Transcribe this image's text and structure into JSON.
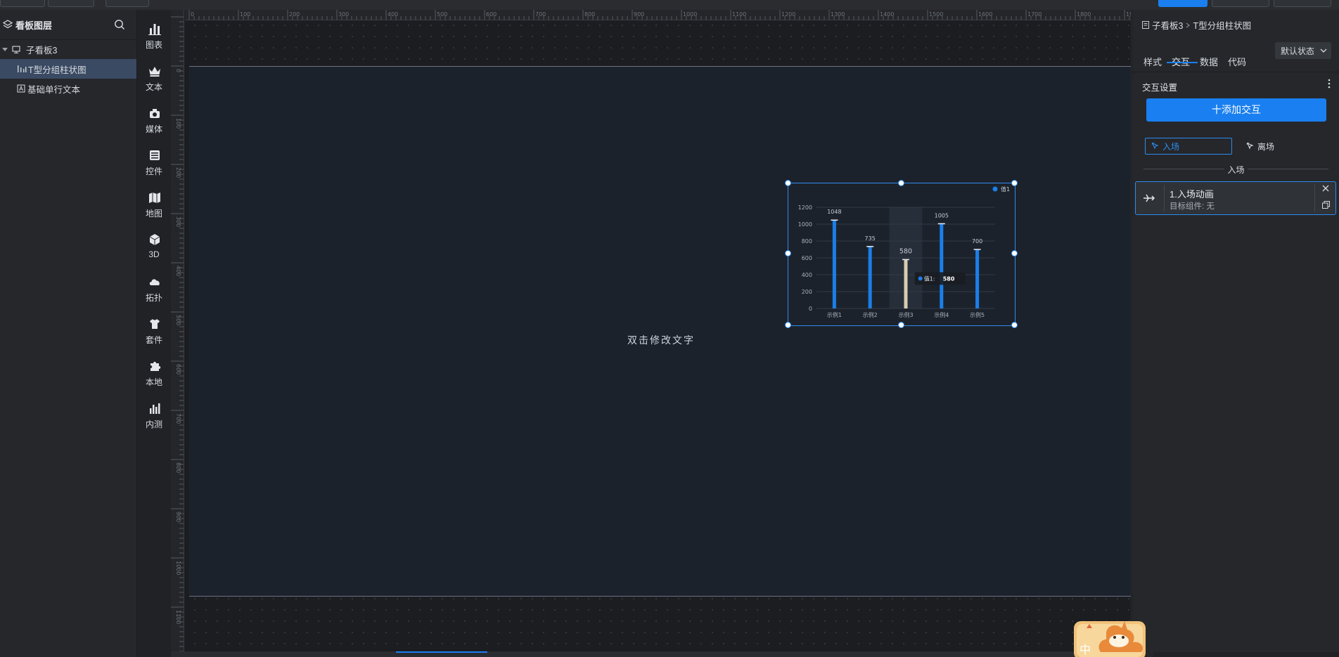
{
  "layers": {
    "title": "看板图层",
    "items": [
      {
        "label": "子看板3"
      },
      {
        "label": "T型分组柱状图"
      },
      {
        "label": "基础单行文本"
      }
    ]
  },
  "tools": [
    {
      "label": "图表",
      "icon": "bar-chart-icon"
    },
    {
      "label": "文本",
      "icon": "crown-icon"
    },
    {
      "label": "媒体",
      "icon": "media-icon"
    },
    {
      "label": "控件",
      "icon": "control-icon"
    },
    {
      "label": "地图",
      "icon": "map-icon"
    },
    {
      "label": "3D",
      "icon": "cube-icon"
    },
    {
      "label": "拓扑",
      "icon": "cloud-icon"
    },
    {
      "label": "套件",
      "icon": "shirt-icon"
    },
    {
      "label": "本地",
      "icon": "puzzle-icon"
    },
    {
      "label": "内测",
      "icon": "chart-icon"
    }
  ],
  "ruler": {
    "h_ticks": [
      "0",
      "100",
      "200",
      "300",
      "400",
      "500",
      "600",
      "700",
      "800",
      "900",
      "1000",
      "1100",
      "1200",
      "1300",
      "1400",
      "1500",
      "1600",
      "1700",
      "1800",
      "1900"
    ],
    "v_ticks": [
      "0",
      "100",
      "200",
      "300",
      "400",
      "500",
      "600",
      "700",
      "800",
      "900",
      "1000",
      "1100"
    ]
  },
  "canvas": {
    "placeholder_text": "双击修改文字"
  },
  "chart_data": {
    "type": "bar",
    "categories": [
      "示例1",
      "示例2",
      "示例3",
      "示例4",
      "示例5"
    ],
    "series": [
      {
        "name": "值1",
        "values": [
          1048,
          735,
          580,
          1005,
          700
        ]
      }
    ],
    "ylim": [
      0,
      1200
    ],
    "yticks": [
      "0",
      "200",
      "400",
      "600",
      "800",
      "1000",
      "1200"
    ],
    "grid": true,
    "legend": "top-right",
    "highlight_index": 2,
    "tooltip": {
      "label": "值1:",
      "value": "580"
    },
    "bar_color": "#1a7fe8",
    "highlight_color": "#d8ccb0"
  },
  "props": {
    "breadcrumb": {
      "parent": "子看板3",
      "current": "T型分组柱状图"
    },
    "tabs": [
      "样式",
      "交互",
      "数据",
      "代码"
    ],
    "state_select": "默认状态",
    "section_title": "交互设置",
    "add_button": "十添加交互",
    "triggers": {
      "enter": "入场",
      "leave": "离场"
    },
    "divider_label": "入场",
    "action": {
      "title": "1.入场动画",
      "subtitle": "目标组件: 无"
    }
  },
  "mascot": {
    "label": "中"
  },
  "colors": {
    "accent": "#1a7ff0",
    "panel": "#25272b",
    "board": "#1c222c"
  }
}
